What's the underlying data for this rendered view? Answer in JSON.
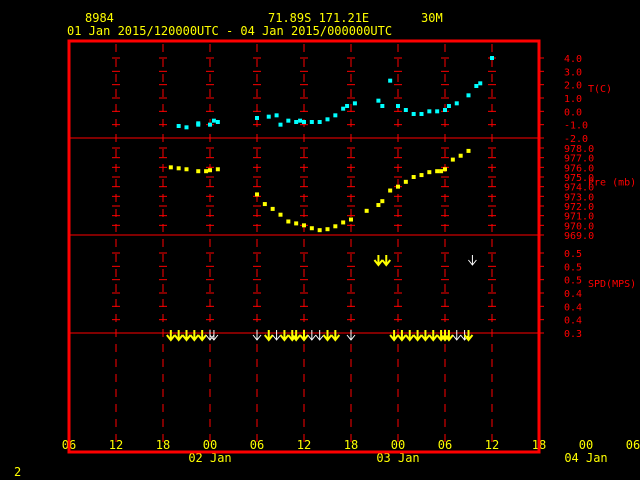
{
  "header": {
    "station_id": "8984",
    "location": "71.89S  171.21E",
    "interval": "30M",
    "date_range": "01 Jan 2015/120000UTC - 04 Jan 2015/000000UTC"
  },
  "footer": {
    "page_number": "2"
  },
  "colors": {
    "background": "#000000",
    "frame": "#ff0000",
    "grid": "#ff0000",
    "axis_text": "#ff0000",
    "header_text": "#ffff00",
    "temperature": "#00ffff",
    "pressure": "#ffff00",
    "wind": "#ffff00",
    "wind_light": "#ffffff"
  },
  "chart_data": [
    {
      "type": "scatter",
      "name": "temperature",
      "ylabel": "T(C)",
      "ylim": [
        -2.0,
        4.0
      ],
      "yticks": [
        "4.0",
        "3.0",
        "2.0",
        "1.0",
        "0.0",
        "-1.0",
        "-2.0"
      ],
      "x_unit": "hours since 01 Jan 2015 06UTC",
      "points": [
        [
          14,
          -1.1
        ],
        [
          15,
          -1.2
        ],
        [
          16.5,
          -0.9
        ],
        [
          16.5,
          -1.0
        ],
        [
          18,
          -1.0
        ],
        [
          18.5,
          -0.7
        ],
        [
          19,
          -0.8
        ],
        [
          24,
          -0.5
        ],
        [
          25.5,
          -0.4
        ],
        [
          26.5,
          -0.3
        ],
        [
          27,
          -1.0
        ],
        [
          28,
          -0.7
        ],
        [
          29,
          -0.8
        ],
        [
          29.5,
          -0.7
        ],
        [
          30,
          -0.8
        ],
        [
          31,
          -0.8
        ],
        [
          32,
          -0.8
        ],
        [
          33,
          -0.6
        ],
        [
          34,
          -0.3
        ],
        [
          35,
          0.2
        ],
        [
          35.5,
          0.4
        ],
        [
          36.5,
          0.6
        ],
        [
          39.5,
          0.8
        ],
        [
          40,
          0.4
        ],
        [
          41,
          2.3
        ],
        [
          42,
          0.4
        ],
        [
          43,
          0.1
        ],
        [
          44,
          -0.2
        ],
        [
          45,
          -0.2
        ],
        [
          46,
          0.0
        ],
        [
          47,
          0.0
        ],
        [
          48,
          0.1
        ],
        [
          48.5,
          0.4
        ],
        [
          49.5,
          0.6
        ],
        [
          51,
          1.2
        ],
        [
          52,
          1.9
        ],
        [
          52.5,
          2.1
        ],
        [
          54,
          4.0
        ]
      ]
    },
    {
      "type": "scatter",
      "name": "pressure",
      "ylabel": "Pre (mb)",
      "ylim": [
        969.0,
        978.0
      ],
      "yticks": [
        "978.0",
        "977.0",
        "976.0",
        "975.0",
        "974.0",
        "973.0",
        "972.0",
        "971.0",
        "970.0",
        "969.0"
      ],
      "points": [
        [
          13,
          976.0
        ],
        [
          14,
          975.9
        ],
        [
          15,
          975.8
        ],
        [
          16.5,
          975.6
        ],
        [
          17.5,
          975.6
        ],
        [
          18,
          975.7
        ],
        [
          19,
          975.8
        ],
        [
          24,
          973.2
        ],
        [
          25,
          972.2
        ],
        [
          26,
          971.7
        ],
        [
          27,
          971.1
        ],
        [
          28,
          970.4
        ],
        [
          29,
          970.2
        ],
        [
          30,
          970.0
        ],
        [
          31,
          969.7
        ],
        [
          32,
          969.5
        ],
        [
          33,
          969.6
        ],
        [
          34,
          969.9
        ],
        [
          35,
          970.3
        ],
        [
          36,
          970.6
        ],
        [
          38,
          971.5
        ],
        [
          39.5,
          972.1
        ],
        [
          40,
          972.5
        ],
        [
          41,
          973.6
        ],
        [
          42,
          974.0
        ],
        [
          43,
          974.5
        ],
        [
          44,
          975.0
        ],
        [
          45,
          975.2
        ],
        [
          46,
          975.5
        ],
        [
          47,
          975.6
        ],
        [
          47.5,
          975.6
        ],
        [
          48,
          975.8
        ],
        [
          49,
          976.8
        ],
        [
          50,
          977.2
        ],
        [
          51,
          977.7
        ]
      ]
    },
    {
      "type": "wind-arrows",
      "name": "wind speed",
      "ylabel": "SPD(MPS)",
      "ylim": [
        0.3,
        0.5
      ],
      "yticks": [
        "0.5",
        "0.5",
        "0.5",
        "0.4",
        "0.4",
        "0.4",
        "0.3"
      ],
      "arrows": [
        {
          "x": 39.5,
          "level": "high",
          "strength": "strong"
        },
        {
          "x": 40.5,
          "level": "high",
          "strength": "strong"
        },
        {
          "x": 51.5,
          "level": "high",
          "strength": "light"
        },
        {
          "x": 13,
          "level": "low",
          "strength": "strong"
        },
        {
          "x": 14,
          "level": "low",
          "strength": "strong"
        },
        {
          "x": 15,
          "level": "low",
          "strength": "strong"
        },
        {
          "x": 16,
          "level": "low",
          "strength": "strong"
        },
        {
          "x": 17,
          "level": "low",
          "strength": "strong"
        },
        {
          "x": 18,
          "level": "low",
          "strength": "light"
        },
        {
          "x": 18.5,
          "level": "low",
          "strength": "light"
        },
        {
          "x": 24,
          "level": "low",
          "strength": "light"
        },
        {
          "x": 25.5,
          "level": "low",
          "strength": "strong"
        },
        {
          "x": 26.5,
          "level": "low",
          "strength": "light"
        },
        {
          "x": 27.5,
          "level": "low",
          "strength": "strong"
        },
        {
          "x": 28.5,
          "level": "low",
          "strength": "strong"
        },
        {
          "x": 29,
          "level": "low",
          "strength": "strong"
        },
        {
          "x": 30,
          "level": "low",
          "strength": "strong"
        },
        {
          "x": 31,
          "level": "low",
          "strength": "light"
        },
        {
          "x": 32,
          "level": "low",
          "strength": "light"
        },
        {
          "x": 33,
          "level": "low",
          "strength": "strong"
        },
        {
          "x": 34,
          "level": "low",
          "strength": "strong"
        },
        {
          "x": 36,
          "level": "low",
          "strength": "light"
        },
        {
          "x": 41.5,
          "level": "low",
          "strength": "strong"
        },
        {
          "x": 42.5,
          "level": "low",
          "strength": "strong"
        },
        {
          "x": 43.5,
          "level": "low",
          "strength": "strong"
        },
        {
          "x": 44.5,
          "level": "low",
          "strength": "strong"
        },
        {
          "x": 45.5,
          "level": "low",
          "strength": "strong"
        },
        {
          "x": 46.5,
          "level": "low",
          "strength": "strong"
        },
        {
          "x": 47.5,
          "level": "low",
          "strength": "strong"
        },
        {
          "x": 48,
          "level": "low",
          "strength": "strong"
        },
        {
          "x": 48.5,
          "level": "low",
          "strength": "strong"
        },
        {
          "x": 49.5,
          "level": "low",
          "strength": "light"
        },
        {
          "x": 50.5,
          "level": "low",
          "strength": "light"
        },
        {
          "x": 51,
          "level": "low",
          "strength": "strong"
        }
      ]
    }
  ],
  "x_axis": {
    "range": [
      0,
      60
    ],
    "tick_labels": [
      "06",
      "12",
      "18",
      "00",
      "06",
      "12",
      "18",
      "00",
      "06",
      "12",
      "18",
      "00",
      "06"
    ],
    "date_labels": [
      {
        "label": "02 Jan",
        "at": 18
      },
      {
        "label": "03 Jan",
        "at": 42
      },
      {
        "label": "04 Jan",
        "at": 66
      }
    ]
  }
}
